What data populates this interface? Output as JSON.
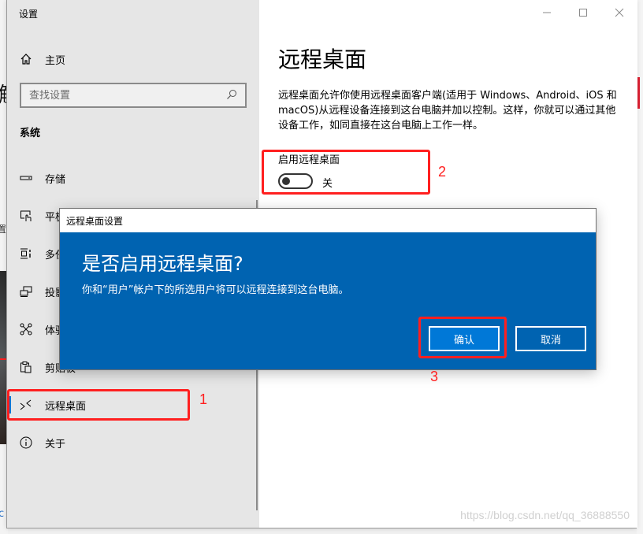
{
  "window": {
    "app_title": "设置",
    "controls": {
      "minimize": "minimize-icon",
      "maximize": "maximize-icon",
      "close": "close-icon"
    }
  },
  "sidebar": {
    "home_label": "主页",
    "search_placeholder": "查找设置",
    "section_title": "系统",
    "items": [
      {
        "label": "存储",
        "icon": "storage-icon",
        "selected": false
      },
      {
        "label": "平板模式",
        "icon": "tablet-mode-icon",
        "selected": false
      },
      {
        "label": "多任务处理",
        "icon": "multitasking-icon",
        "selected": false
      },
      {
        "label": "投影到此电脑",
        "icon": "project-icon",
        "selected": false
      },
      {
        "label": "体验共享",
        "icon": "shared-experiences-icon",
        "selected": false
      },
      {
        "label": "剪贴板",
        "icon": "clipboard-icon",
        "selected": false
      },
      {
        "label": "远程桌面",
        "icon": "remote-desktop-icon",
        "selected": true
      },
      {
        "label": "关于",
        "icon": "info-icon",
        "selected": false
      }
    ]
  },
  "main": {
    "title": "远程桌面",
    "description": "远程桌面允许你使用远程桌面客户端(适用于 Windows、Android、iOS 和 macOS)从远程设备连接到这台电脑并加以控制。这样，你就可以通过其他设备工作，如同直接在这台电脑上工作一样。",
    "toggle_label": "启用远程桌面",
    "toggle_state": "关",
    "toggle_on": false
  },
  "dialog": {
    "title": "远程桌面设置",
    "heading": "是否启用远程桌面?",
    "body": "你和“用户”帐户下的所选用户将可以远程连接到这台电脑。",
    "confirm_label": "确认",
    "cancel_label": "取消"
  },
  "annotations": [
    {
      "number": "1",
      "target": "sidebar-item-remote-desktop"
    },
    {
      "number": "2",
      "target": "remote-desktop-toggle"
    },
    {
      "number": "3",
      "target": "confirm-button"
    }
  ],
  "annotation_color": "#ff1f1f",
  "accent_color": "#0078d7",
  "dialog_color": "#0063b1",
  "watermark": "https://blog.csdn.net/qq_36888550"
}
